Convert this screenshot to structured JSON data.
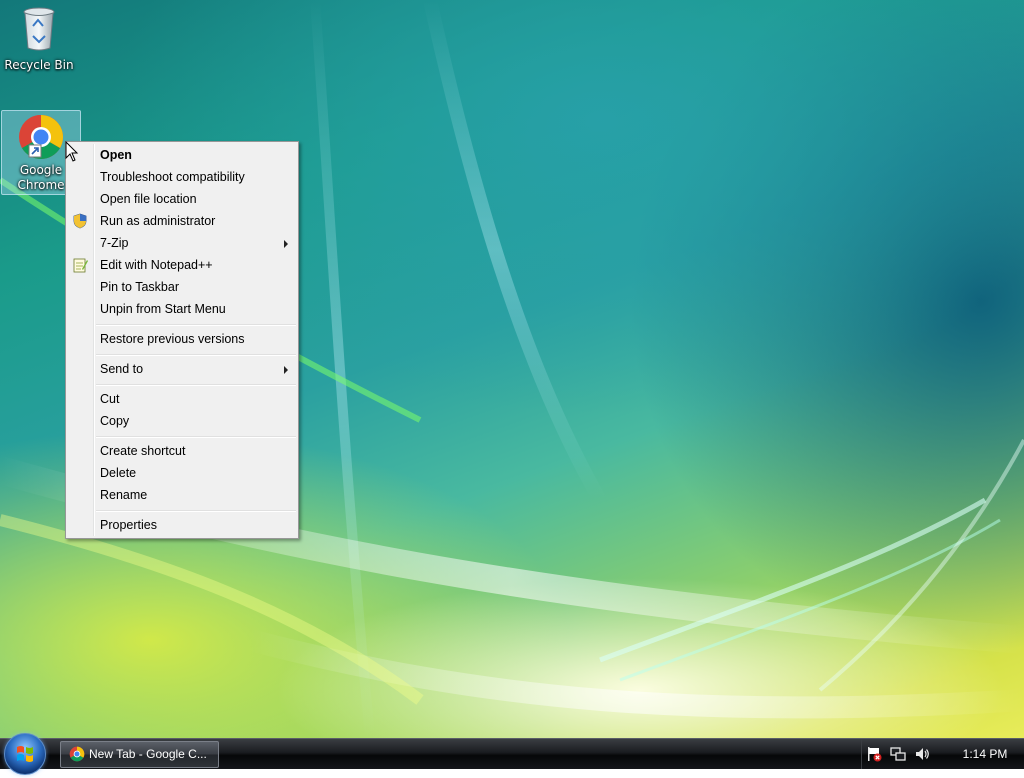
{
  "desktop": {
    "icons": [
      {
        "label": "Recycle Bin",
        "icon": "recycle-bin-icon"
      },
      {
        "label": "Google\nChrome",
        "icon": "chrome-icon",
        "selected": true
      }
    ]
  },
  "context_menu": {
    "items": [
      {
        "label": "Open",
        "bold": true
      },
      {
        "label": "Troubleshoot compatibility"
      },
      {
        "label": "Open file location"
      },
      {
        "label": "Run as administrator",
        "icon": "uac-shield-icon"
      },
      {
        "label": "7-Zip",
        "submenu": true
      },
      {
        "label": "Edit with Notepad++",
        "icon": "notepad-plus-plus-icon"
      },
      {
        "label": "Pin to Taskbar"
      },
      {
        "label": "Unpin from Start Menu"
      },
      {
        "label": "Restore previous versions"
      },
      {
        "label": "Send to",
        "submenu": true
      },
      {
        "label": "Cut"
      },
      {
        "label": "Copy"
      },
      {
        "label": "Create shortcut"
      },
      {
        "label": "Delete"
      },
      {
        "label": "Rename"
      },
      {
        "label": "Properties"
      }
    ]
  },
  "taskbar": {
    "start_button": "start-orb-icon",
    "tasks": [
      {
        "label": "New Tab - Google C...",
        "icon": "chrome-icon"
      }
    ],
    "tray": {
      "icons": [
        "action-center-flag-icon",
        "network-icon",
        "volume-icon"
      ],
      "clock": "1:14 PM"
    }
  },
  "colors": {
    "menu_bg": "#f0f0f0",
    "menu_border": "#979797",
    "taskbar_bg": "#0b0c0e",
    "selection": "#bfe4ff"
  }
}
